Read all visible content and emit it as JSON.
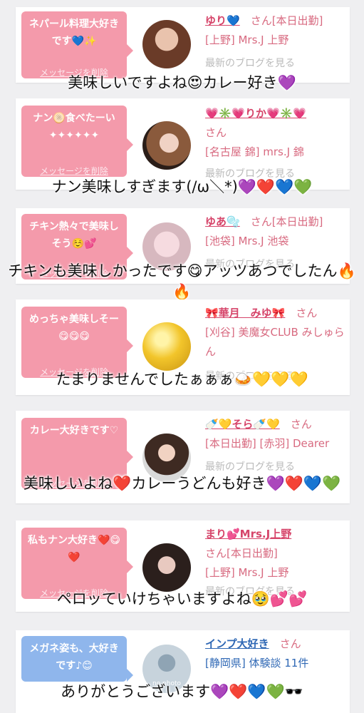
{
  "posts": [
    {
      "bubble": "ネパール料理大好きです💙✨",
      "delete_label": "メッセージを削除",
      "name": "ゆり💙",
      "san": "さん[本日出勤]",
      "shop": "[上野] Mrs.J 上野",
      "blog": "最新のブログを見る",
      "overlay": "美味しいですよね😍カレー好き💜"
    },
    {
      "bubble": "ナン🫓食べたーい ✦✦✦✦✦✦",
      "delete_label": "メッセージを削除",
      "name": "💗✳️💗りか💗✳️💗",
      "san": "さん",
      "shop": "[名古屋 錦] mrs.J 錦",
      "blog": "最新のブログを見る",
      "overlay": "ナン美味しすぎます(/ω＼*)💜❤️💙💚"
    },
    {
      "bubble": "チキン熱々で美味しそう☺️💕",
      "delete_label": "メッセージを削除",
      "name": "ゆあ🫧",
      "san": "さん[本日出勤]",
      "shop": "[池袋] Mrs.J 池袋",
      "blog": "最新のブログを見る",
      "overlay": "チキンも美味しかったです😋アッツあつでしたん🔥🔥"
    },
    {
      "bubble": "めっちゃ美味しそー😋😋😋",
      "delete_label": "メッセージを削除",
      "name": "🎀華月　みゆ🎀",
      "san": "さん",
      "shop": "[刈谷] 美魔女CLUB みしゅらん",
      "blog": "最新のブログを見る",
      "overlay": "たまりませんでしたぁぁぁ🍛💛💛💛"
    },
    {
      "bubble": "カレー大好きです♡",
      "delete_label": "メッセージを削除",
      "name": "🍼💛そら🍼💛",
      "san": "さん",
      "shop": "[本日出勤] [赤羽] Dearer",
      "blog": "最新のブログを見る",
      "overlay": "美味しいよね❤️カレーうどんも好き💜❤️💙💚"
    },
    {
      "bubble": "私もナン大好き❤️😋❤️",
      "delete_label": "メッセージを削除",
      "name": "まり💕Mrs.J上野",
      "san": "さん[本日出勤]",
      "shop": "[上野] Mrs.J 上野",
      "blog": "最新のブログを見る",
      "overlay": "ペロッていけちゃいますよね🥹💕💕"
    },
    {
      "bubble": "メガネ姿も、大好きです♪😊",
      "name": "インプ大好き",
      "san": "さん",
      "shop": "[静岡県] 体験談 11件",
      "avatar_caption": "no photo",
      "overlay": "ありがとうございます💜❤️💙💚🕶️"
    }
  ],
  "colors": {
    "bubble_pink": "#f49aab",
    "bubble_blue": "#8fb6ec",
    "name_pink": "#d6456a",
    "name_blue": "#2f68b5"
  }
}
